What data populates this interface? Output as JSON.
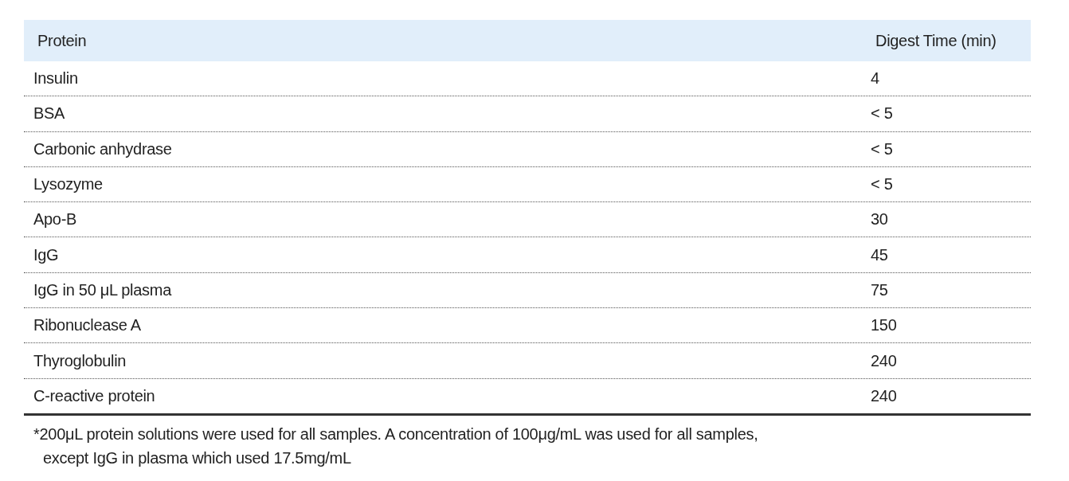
{
  "table": {
    "columns": [
      "Protein",
      "Digest Time (min)"
    ],
    "rows": [
      [
        "Insulin",
        "4"
      ],
      [
        "BSA",
        "< 5"
      ],
      [
        "Carbonic anhydrase",
        "< 5"
      ],
      [
        "Lysozyme",
        "< 5"
      ],
      [
        "Apo-B",
        "30"
      ],
      [
        "IgG",
        "45"
      ],
      [
        "IgG in 50 μL plasma",
        "75"
      ],
      [
        "Ribonuclease A",
        "150"
      ],
      [
        "Thyroglobulin",
        "240"
      ],
      [
        "C-reactive protein",
        "240"
      ]
    ]
  },
  "footnote": [
    "*200μL protein solutions were used for all samples. A concentration of 100μg/mL was used for all samples,",
    "except IgG in plasma which used 17.5mg/mL"
  ]
}
